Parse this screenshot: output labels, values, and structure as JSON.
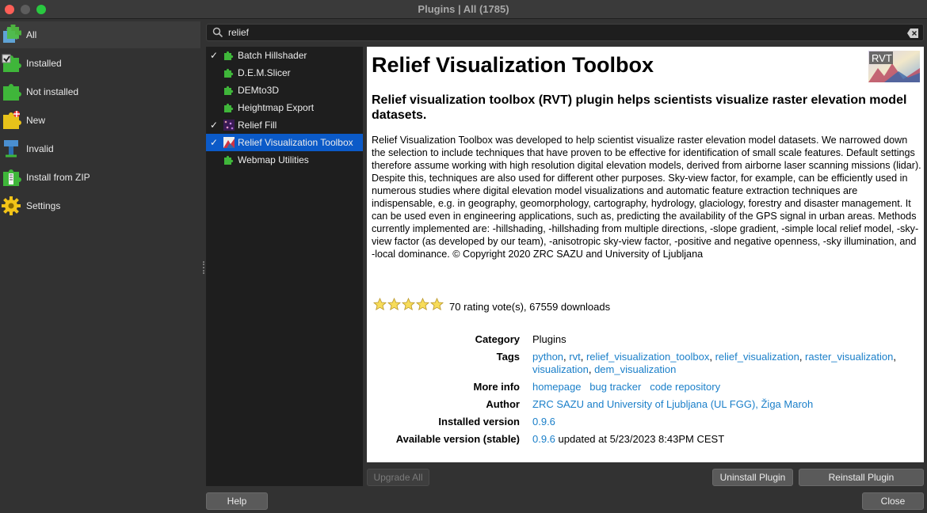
{
  "window": {
    "title": "Plugins | All (1785)"
  },
  "sidebar": {
    "items": [
      {
        "label": "All",
        "icon": "all-plugins-icon"
      },
      {
        "label": "Installed",
        "icon": "installed-plugins-icon"
      },
      {
        "label": "Not installed",
        "icon": "not-installed-plugins-icon"
      },
      {
        "label": "New",
        "icon": "new-plugins-icon"
      },
      {
        "label": "Invalid",
        "icon": "invalid-plugins-icon"
      },
      {
        "label": "Install from ZIP",
        "icon": "install-zip-icon"
      },
      {
        "label": "Settings",
        "icon": "settings-gear-icon"
      }
    ]
  },
  "search": {
    "value": "relief"
  },
  "plugins": [
    {
      "name": "Batch Hillshader",
      "checked": "✓"
    },
    {
      "name": "D.E.M.Slicer",
      "checked": ""
    },
    {
      "name": "DEMto3D",
      "checked": ""
    },
    {
      "name": "Heightmap Export",
      "checked": ""
    },
    {
      "name": "Relief Fill",
      "checked": "✓"
    },
    {
      "name": "Relief Visualization Toolbox",
      "checked": "✓"
    },
    {
      "name": "Webmap Utilities",
      "checked": ""
    }
  ],
  "detail": {
    "title": "Relief Visualization Toolbox",
    "logo_text": "RVT",
    "subtitle": "Relief visualization toolbox (RVT) plugin helps scientists visualize raster elevation model datasets.",
    "description": "Relief Visualization Toolbox was developed to help scientist visualize raster elevation model datasets. We narrowed down the selection to include techniques that have proven to be effective for identification of small scale features. Default settings therefore assume working with high resolution digital elevation models, derived from airborne laser scanning missions (lidar). Despite this, techniques are also used for different other purposes. Sky-view factor, for example, can be efficiently used in numerous studies where digital elevation model visualizations and automatic feature extraction techniques are indispensable, e.g. in geography, geomorphology, cartography, hydrology, glaciology, forestry and disaster management. It can be used even in engineering applications, such as, predicting the availability of the GPS signal in urban areas. Methods currently implemented are: -hillshading, -hillshading from multiple directions, -slope gradient, -simple local relief model, -sky-view factor (as developed by our team), -anisotropic sky-view factor, -positive and negative openness, -sky illumination, and -local dominance. © Copyright 2020 ZRC SAZU and University of Ljubljana",
    "rating_stars": 5,
    "votes_text": "70 rating vote(s), 67559 downloads",
    "category_label": "Category",
    "category": "Plugins",
    "tags_label": "Tags",
    "tags": [
      "python",
      "rvt",
      "relief_visualization_toolbox",
      "relief_visualization",
      "raster_visualization",
      "visualization",
      "dem_visualization"
    ],
    "more_info_label": "More info",
    "links": {
      "homepage": "homepage",
      "bug_tracker": "bug tracker",
      "code_repository": "code repository"
    },
    "author_label": "Author",
    "author": "ZRC SAZU and University of Ljubljana (UL FGG), Žiga Maroh",
    "installed_version_label": "Installed version",
    "installed_version": "0.9.6",
    "available_version_label": "Available version (stable)",
    "available_version": "0.9.6",
    "available_updated": "updated at 5/23/2023 8:43PM CEST"
  },
  "buttons": {
    "upgrade_all": "Upgrade All",
    "uninstall": "Uninstall Plugin",
    "reinstall": "Reinstall Plugin",
    "help": "Help",
    "close": "Close"
  },
  "colors": {
    "selection": "#0b5ac8",
    "link": "#1a7fc9",
    "puzzle_green": "#3fb63a"
  }
}
